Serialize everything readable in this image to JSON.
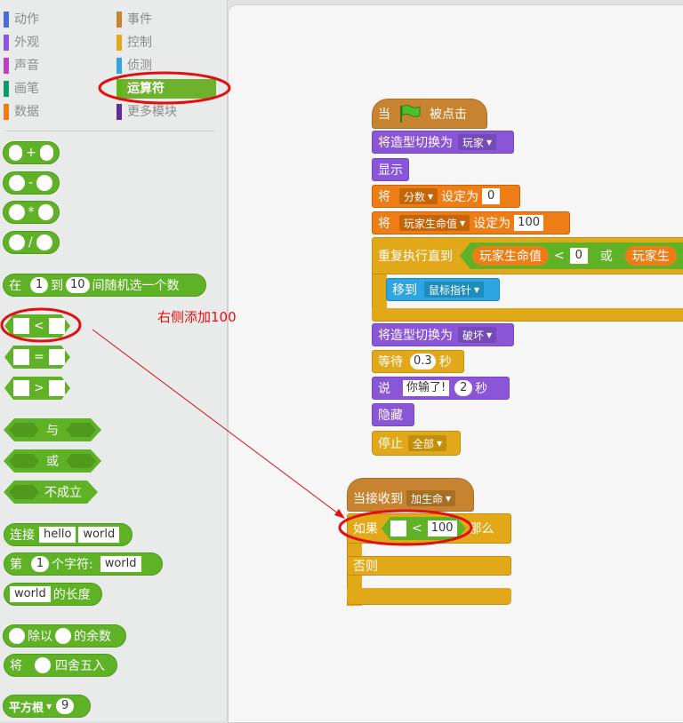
{
  "categories": [
    {
      "label": "动作",
      "color": "#4a6cd4"
    },
    {
      "label": "外观",
      "color": "#8a55d7"
    },
    {
      "label": "声音",
      "color": "#bb42c3"
    },
    {
      "label": "画笔",
      "color": "#0e9a6c"
    },
    {
      "label": "数据",
      "color": "#ee7d16"
    },
    {
      "label": "事件",
      "color": "#c88330"
    },
    {
      "label": "控制",
      "color": "#e1a91a"
    },
    {
      "label": "侦测",
      "color": "#2ca5e2"
    },
    {
      "label": "运算符",
      "color": "#5cb712"
    },
    {
      "label": "更多模块",
      "color": "#632d99"
    }
  ],
  "palette": {
    "plus": "+",
    "minus": "-",
    "times": "*",
    "divide": "/",
    "random_pre": "在",
    "random_a": "1",
    "random_mid": "到",
    "random_b": "10",
    "random_post": "间随机选一个数",
    "lt": "<",
    "eq": "=",
    "gt": ">",
    "and": "与",
    "or": "或",
    "not": "不成立",
    "join": "连接",
    "join_a": "hello",
    "join_b": "world",
    "letter_pre": "第",
    "letter_n": "1",
    "letter_mid": "个字符:",
    "letter_word": "world",
    "length_word": "world",
    "length_post": "的长度",
    "mod_mid": "除以",
    "mod_post": "的余数",
    "round_pre": "将",
    "round_post": "四舍五入",
    "sqrt": "平方根",
    "sqrt_val": "9"
  },
  "script1": {
    "hat_pre": "当",
    "hat_post": "被点击",
    "costume_pre": "将造型切换为",
    "costume_val": "玩家",
    "show": "显示",
    "set1_pre": "将",
    "set1_var": "分数",
    "set1_mid": "设定为",
    "set1_val": "0",
    "set2_pre": "将",
    "set2_var": "玩家生命值",
    "set2_mid": "设定为",
    "set2_val": "100",
    "repeat": "重复执行直到",
    "cond_var": "玩家生命值",
    "cond_op": "<",
    "cond_val": "0",
    "cond_or": "或",
    "cond_var2": "玩家生",
    "goto": "移到",
    "goto_val": "鼠标指针",
    "costume2_pre": "将造型切换为",
    "costume2_val": "破坏",
    "wait": "等待",
    "wait_val": "0.3",
    "wait_unit": "秒",
    "say": "说",
    "say_val": "你输了!",
    "say_secs": "2",
    "say_unit": "秒",
    "hide": "隐藏",
    "stop": "停止",
    "stop_val": "全部"
  },
  "script2": {
    "hat": "当接收到",
    "hat_val": "加生命",
    "if": "如果",
    "op": "<",
    "val": "100",
    "then": "那么",
    "else": "否则"
  },
  "annotation": {
    "text": "右侧添加100",
    "color": "#e01010"
  }
}
